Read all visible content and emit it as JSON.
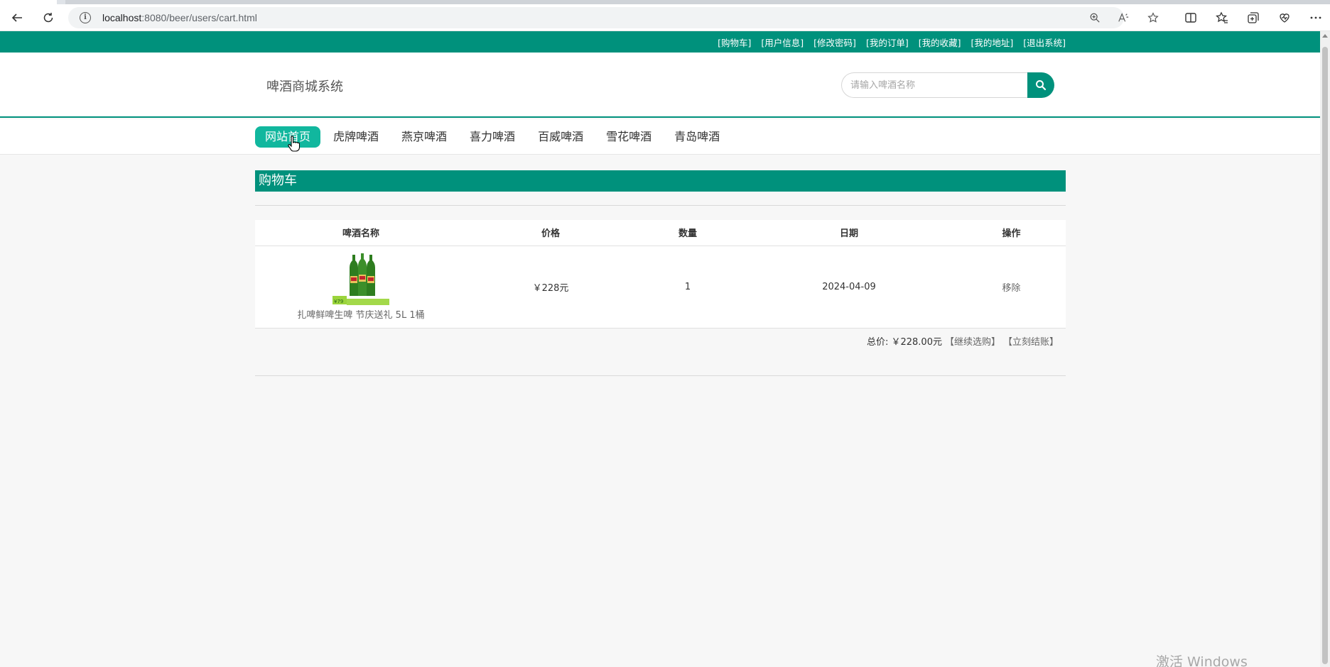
{
  "browser": {
    "url_host": "localhost",
    "url_path": ":8080/beer/users/cart.html"
  },
  "topbar": {
    "links": [
      "[购物车]",
      "[用户信息]",
      "[修改密码]",
      "[我的订单]",
      "[我的收藏]",
      "[我的地址]",
      "[退出系统]"
    ]
  },
  "header": {
    "logo": "啤酒商城系统",
    "search_placeholder": "请输入啤酒名称"
  },
  "nav": {
    "items": [
      "网站首页",
      "虎牌啤酒",
      "燕京啤酒",
      "喜力啤酒",
      "百威啤酒",
      "雪花啤酒",
      "青岛啤酒"
    ],
    "active_index": 0
  },
  "cart": {
    "title": "购物车",
    "columns": [
      "啤酒名称",
      "价格",
      "数量",
      "日期",
      "操作"
    ],
    "rows": [
      {
        "name": "扎啤鲜啤生啤 节庆送礼 5L 1桶",
        "price": "￥228元",
        "quantity": "1",
        "date": "2024-04-09",
        "action": "移除"
      }
    ],
    "total_label": "总价: ￥228.00元",
    "continue_label": "【继续选购】",
    "checkout_label": "【立刻结账】"
  },
  "watermark": "激活 Windows",
  "colors": {
    "primary": "#00917c",
    "nav_active": "#11b79e"
  }
}
